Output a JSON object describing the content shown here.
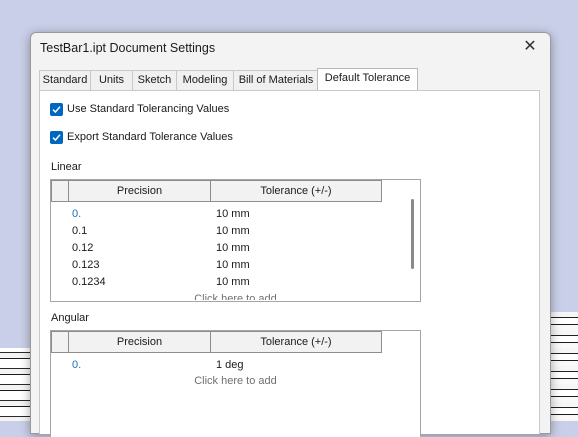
{
  "window": {
    "title": "TestBar1.ipt Document Settings"
  },
  "tabs": [
    {
      "label": "Standard"
    },
    {
      "label": "Units"
    },
    {
      "label": "Sketch"
    },
    {
      "label": "Modeling"
    },
    {
      "label": "Bill of Materials"
    },
    {
      "label": "Default Tolerance"
    }
  ],
  "active_tab": "Default Tolerance",
  "options": {
    "use_standard": {
      "label": "Use Standard Tolerancing Values",
      "checked": true
    },
    "export_standard": {
      "label": "Export Standard Tolerance Values",
      "checked": true
    }
  },
  "linear": {
    "label": "Linear",
    "columns": [
      "Precision",
      "Tolerance (+/-)"
    ],
    "rows": [
      {
        "precision": "0.",
        "tolerance": "10 mm"
      },
      {
        "precision": "0.1",
        "tolerance": "10 mm"
      },
      {
        "precision": "0.12",
        "tolerance": "10 mm"
      },
      {
        "precision": "0.123",
        "tolerance": "10 mm"
      },
      {
        "precision": "0.1234",
        "tolerance": "10 mm"
      }
    ],
    "add_text": "Click here to add"
  },
  "angular": {
    "label": "Angular",
    "columns": [
      "Precision",
      "Tolerance (+/-)"
    ],
    "rows": [
      {
        "precision": "0.",
        "tolerance": "1 deg"
      }
    ],
    "add_text": "Click here to add"
  },
  "colors": {
    "accent": "#0067c0",
    "link_blue": "#1e6fb8"
  },
  "icons": {
    "close": "close-icon",
    "checkbox": "checkmark-icon"
  }
}
